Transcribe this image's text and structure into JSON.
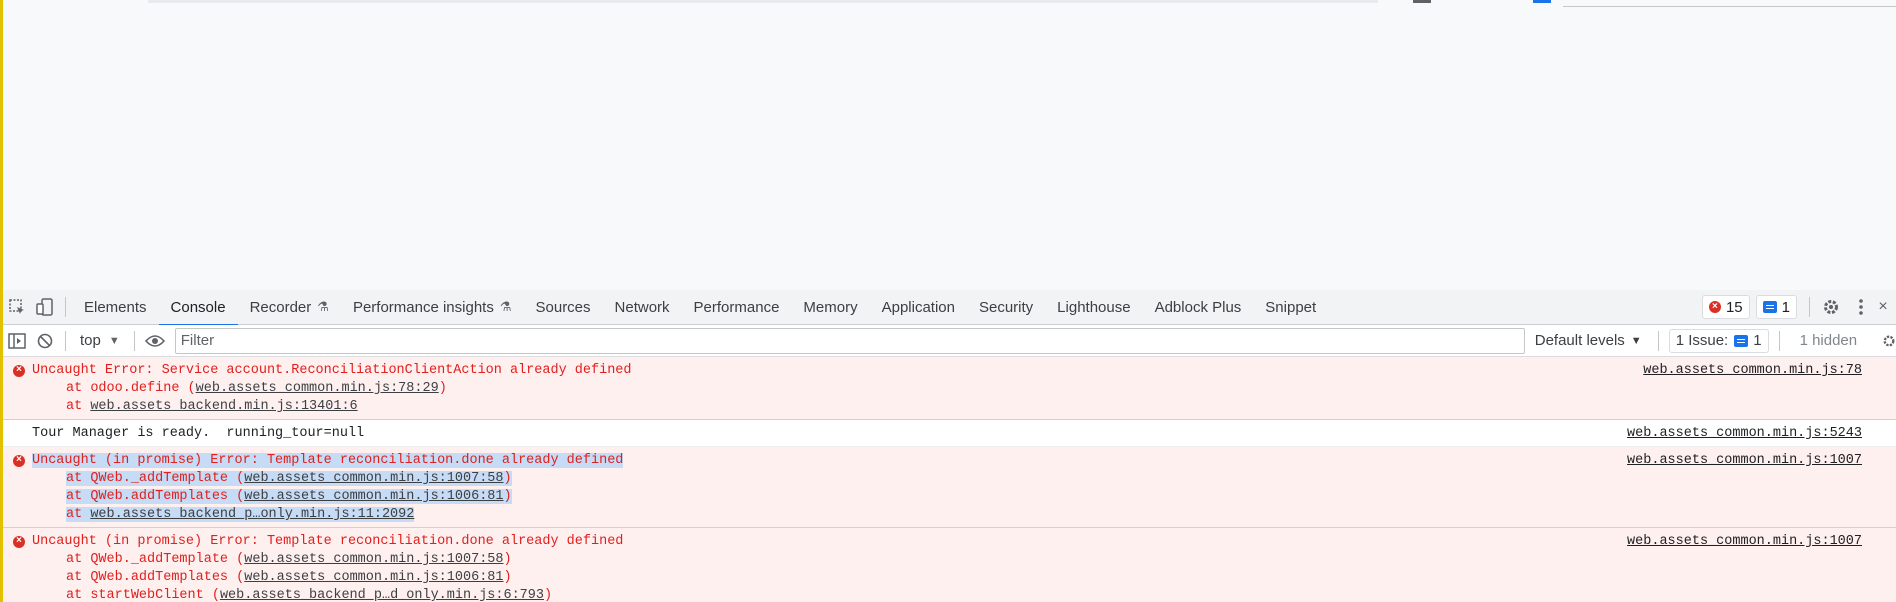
{
  "tabs": [
    {
      "label": "Elements",
      "beaker": false
    },
    {
      "label": "Console",
      "beaker": false,
      "active": true
    },
    {
      "label": "Recorder",
      "beaker": true
    },
    {
      "label": "Performance insights",
      "beaker": true
    },
    {
      "label": "Sources",
      "beaker": false
    },
    {
      "label": "Network",
      "beaker": false
    },
    {
      "label": "Performance",
      "beaker": false
    },
    {
      "label": "Memory",
      "beaker": false
    },
    {
      "label": "Application",
      "beaker": false
    },
    {
      "label": "Security",
      "beaker": false
    },
    {
      "label": "Lighthouse",
      "beaker": false
    },
    {
      "label": "Adblock Plus",
      "beaker": false
    },
    {
      "label": "Snippet",
      "beaker": false
    }
  ],
  "status": {
    "errors": "15",
    "messages": "1"
  },
  "toolbar": {
    "context": "top",
    "filter_placeholder": "Filter",
    "levels": "Default levels",
    "issues_label": "1 Issue:",
    "issues_count": "1",
    "hidden": "1 hidden"
  },
  "messages": [
    {
      "type": "error",
      "text": "Uncaught Error: Service account.ReconciliationClientAction already defined",
      "source": "web.assets_common.min.js:78",
      "selected": false,
      "trace": [
        {
          "fn": "odoo.define",
          "loc": "web.assets_common.min.js:78:29"
        },
        {
          "fn": "",
          "loc": "web.assets_backend.min.js:13401:6"
        }
      ]
    },
    {
      "type": "log",
      "text": "Tour Manager is ready.  running_tour=null",
      "source": "web.assets_common.min.js:5243",
      "selected": false,
      "trace": []
    },
    {
      "type": "error",
      "text": "Uncaught (in promise) Error: Template reconciliation.done already defined",
      "source": "web.assets_common.min.js:1007",
      "selected": true,
      "trace": [
        {
          "fn": "QWeb._addTemplate",
          "loc": "web.assets_common.min.js:1007:58"
        },
        {
          "fn": "QWeb.addTemplates",
          "loc": "web.assets_common.min.js:1006:81"
        },
        {
          "fn": "",
          "loc": "web.assets_backend_p…only.min.js:11:2092"
        }
      ]
    },
    {
      "type": "error",
      "text": "Uncaught (in promise) Error: Template reconciliation.done already defined",
      "source": "web.assets_common.min.js:1007",
      "selected": false,
      "trace": [
        {
          "fn": "QWeb._addTemplate",
          "loc": "web.assets_common.min.js:1007:58"
        },
        {
          "fn": "QWeb.addTemplates",
          "loc": "web.assets_common.min.js:1006:81"
        },
        {
          "fn": "startWebClient",
          "loc": "web.assets_backend_p…d_only.min.js:6:793"
        }
      ]
    }
  ]
}
